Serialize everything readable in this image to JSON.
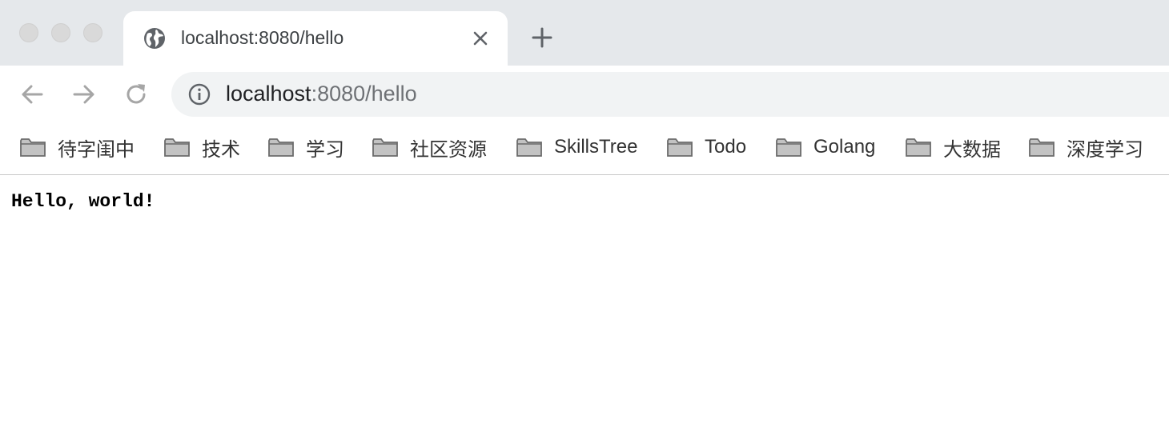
{
  "window": {
    "traffic_lights": [
      "close",
      "minimize",
      "zoom"
    ]
  },
  "tab": {
    "title": "localhost:8080/hello",
    "favicon": "globe-icon",
    "close_icon": "close-icon"
  },
  "new_tab_icon": "plus-icon",
  "toolbar": {
    "back_icon": "arrow-left-icon",
    "forward_icon": "arrow-right-icon",
    "reload_icon": "reload-icon",
    "site_info_icon": "info-icon",
    "url_host": "localhost",
    "url_rest": ":8080/hello"
  },
  "bookmarks": {
    "icon": "folder-icon",
    "items": [
      {
        "label": "待字闺中"
      },
      {
        "label": "技术"
      },
      {
        "label": "学习"
      },
      {
        "label": "社区资源"
      },
      {
        "label": "SkillsTree"
      },
      {
        "label": "Todo"
      },
      {
        "label": "Golang"
      },
      {
        "label": "大数据"
      },
      {
        "label": "深度学习"
      }
    ]
  },
  "page": {
    "body_text": "Hello, world!"
  },
  "colors": {
    "tabstrip_bg": "#e5e8eb",
    "omnibox_bg": "#f1f3f4",
    "icon_gray": "#5f6368",
    "disabled_icon": "#a6a6a6"
  }
}
